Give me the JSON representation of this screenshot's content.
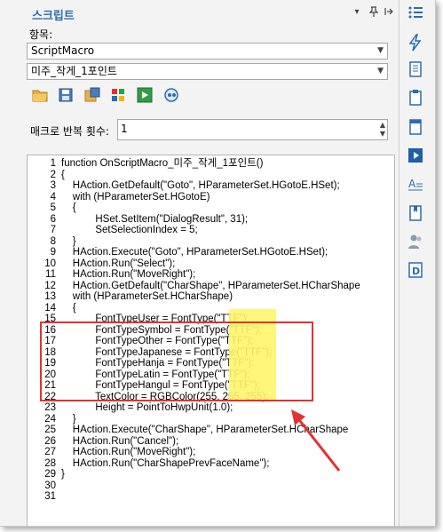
{
  "panel": {
    "title": "스크립트",
    "title_buttons": [
      "chevron-down-icon",
      "pin-icon",
      "expand-icon"
    ],
    "item_label": "항목:",
    "item_select": "ScriptMacro",
    "macro_select": "미주_작게_1포인트",
    "toolbar": [
      "open-folder-icon",
      "save-icon",
      "save-as-icon",
      "edit-icon",
      "run-icon",
      "record-icon"
    ],
    "repeat_label": "매크로 반복 횟수:",
    "repeat_value": "1"
  },
  "code_lines": [
    {
      "n": "1",
      "text": "function OnScriptMacro_미주_작게_1포인트()"
    },
    {
      "n": "2",
      "text": "{"
    },
    {
      "n": "3",
      "text": "    HAction.GetDefault(\"Goto\", HParameterSet.HGotoE.HSet);"
    },
    {
      "n": "4",
      "text": "    with (HParameterSet.HGotoE)"
    },
    {
      "n": "5",
      "text": "    {"
    },
    {
      "n": "6",
      "text": "            HSet.SetItem(\"DialogResult\", 31);"
    },
    {
      "n": "7",
      "text": "            SetSelectionIndex = 5;"
    },
    {
      "n": "8",
      "text": "    }"
    },
    {
      "n": "9",
      "text": "    HAction.Execute(\"Goto\", HParameterSet.HGotoE.HSet);"
    },
    {
      "n": "10",
      "text": "    HAction.Run(\"Select\");"
    },
    {
      "n": "11",
      "text": "    HAction.Run(\"MoveRight\");"
    },
    {
      "n": "12",
      "text": "    HAction.GetDefault(\"CharShape\", HParameterSet.HCharShape"
    },
    {
      "n": "13",
      "text": "    with (HParameterSet.HCharShape)"
    },
    {
      "n": "14",
      "text": "    {"
    },
    {
      "n": "15",
      "text": "            FontTypeUser = FontType(\"TTF\");"
    },
    {
      "n": "16",
      "text": "            FontTypeSymbol = FontType(\"TTF\");"
    },
    {
      "n": "17",
      "text": "            FontTypeOther = FontType(\"TTF\");"
    },
    {
      "n": "18",
      "text": "            FontTypeJapanese = FontType(\"TTF\");"
    },
    {
      "n": "19",
      "text": "            FontTypeHanja = FontType(\"TTF\");"
    },
    {
      "n": "20",
      "text": "            FontTypeLatin = FontType(\"TTF\");"
    },
    {
      "n": "21",
      "text": "            FontTypeHangul = FontType(\"TTF\");"
    },
    {
      "n": "22",
      "text": "            TextColor = RGBColor(255, 255, 255);"
    },
    {
      "n": "23",
      "text": "            Height = PointToHwpUnit(1.0);"
    },
    {
      "n": "24",
      "text": "    }"
    },
    {
      "n": "25",
      "text": "    HAction.Execute(\"CharShape\", HParameterSet.HCharShape"
    },
    {
      "n": "26",
      "text": "    HAction.Run(\"Cancel\");"
    },
    {
      "n": "27",
      "text": "    HAction.Run(\"MoveRight\");"
    },
    {
      "n": "28",
      "text": "    HAction.Run(\"CharShapePrevFaceName\");"
    },
    {
      "n": "29",
      "text": "}"
    },
    {
      "n": "30",
      "text": ""
    },
    {
      "n": "31",
      "text": ""
    }
  ],
  "sidebar_icons": [
    "list-icon",
    "lightning-icon",
    "document-icon",
    "clipboard-icon",
    "page-icon",
    "play-icon",
    "text-style-icon",
    "bookmark-icon",
    "people-icon",
    "d-icon"
  ],
  "colors": {
    "accent": "#2b6cb0",
    "highlight": "#fff24d",
    "annotation": "#e53030"
  }
}
